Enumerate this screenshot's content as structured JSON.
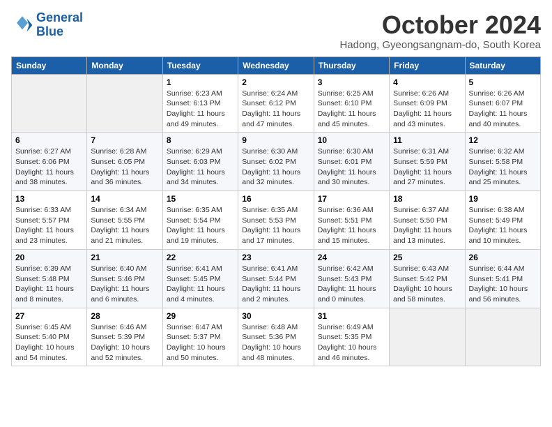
{
  "logo": {
    "line1": "General",
    "line2": "Blue"
  },
  "title": "October 2024",
  "subtitle": "Hadong, Gyeongsangnam-do, South Korea",
  "days_of_week": [
    "Sunday",
    "Monday",
    "Tuesday",
    "Wednesday",
    "Thursday",
    "Friday",
    "Saturday"
  ],
  "weeks": [
    [
      {
        "day": "",
        "content": ""
      },
      {
        "day": "",
        "content": ""
      },
      {
        "day": "1",
        "content": "Sunrise: 6:23 AM\nSunset: 6:13 PM\nDaylight: 11 hours and 49 minutes."
      },
      {
        "day": "2",
        "content": "Sunrise: 6:24 AM\nSunset: 6:12 PM\nDaylight: 11 hours and 47 minutes."
      },
      {
        "day": "3",
        "content": "Sunrise: 6:25 AM\nSunset: 6:10 PM\nDaylight: 11 hours and 45 minutes."
      },
      {
        "day": "4",
        "content": "Sunrise: 6:26 AM\nSunset: 6:09 PM\nDaylight: 11 hours and 43 minutes."
      },
      {
        "day": "5",
        "content": "Sunrise: 6:26 AM\nSunset: 6:07 PM\nDaylight: 11 hours and 40 minutes."
      }
    ],
    [
      {
        "day": "6",
        "content": "Sunrise: 6:27 AM\nSunset: 6:06 PM\nDaylight: 11 hours and 38 minutes."
      },
      {
        "day": "7",
        "content": "Sunrise: 6:28 AM\nSunset: 6:05 PM\nDaylight: 11 hours and 36 minutes."
      },
      {
        "day": "8",
        "content": "Sunrise: 6:29 AM\nSunset: 6:03 PM\nDaylight: 11 hours and 34 minutes."
      },
      {
        "day": "9",
        "content": "Sunrise: 6:30 AM\nSunset: 6:02 PM\nDaylight: 11 hours and 32 minutes."
      },
      {
        "day": "10",
        "content": "Sunrise: 6:30 AM\nSunset: 6:01 PM\nDaylight: 11 hours and 30 minutes."
      },
      {
        "day": "11",
        "content": "Sunrise: 6:31 AM\nSunset: 5:59 PM\nDaylight: 11 hours and 27 minutes."
      },
      {
        "day": "12",
        "content": "Sunrise: 6:32 AM\nSunset: 5:58 PM\nDaylight: 11 hours and 25 minutes."
      }
    ],
    [
      {
        "day": "13",
        "content": "Sunrise: 6:33 AM\nSunset: 5:57 PM\nDaylight: 11 hours and 23 minutes."
      },
      {
        "day": "14",
        "content": "Sunrise: 6:34 AM\nSunset: 5:55 PM\nDaylight: 11 hours and 21 minutes."
      },
      {
        "day": "15",
        "content": "Sunrise: 6:35 AM\nSunset: 5:54 PM\nDaylight: 11 hours and 19 minutes."
      },
      {
        "day": "16",
        "content": "Sunrise: 6:35 AM\nSunset: 5:53 PM\nDaylight: 11 hours and 17 minutes."
      },
      {
        "day": "17",
        "content": "Sunrise: 6:36 AM\nSunset: 5:51 PM\nDaylight: 11 hours and 15 minutes."
      },
      {
        "day": "18",
        "content": "Sunrise: 6:37 AM\nSunset: 5:50 PM\nDaylight: 11 hours and 13 minutes."
      },
      {
        "day": "19",
        "content": "Sunrise: 6:38 AM\nSunset: 5:49 PM\nDaylight: 11 hours and 10 minutes."
      }
    ],
    [
      {
        "day": "20",
        "content": "Sunrise: 6:39 AM\nSunset: 5:48 PM\nDaylight: 11 hours and 8 minutes."
      },
      {
        "day": "21",
        "content": "Sunrise: 6:40 AM\nSunset: 5:46 PM\nDaylight: 11 hours and 6 minutes."
      },
      {
        "day": "22",
        "content": "Sunrise: 6:41 AM\nSunset: 5:45 PM\nDaylight: 11 hours and 4 minutes."
      },
      {
        "day": "23",
        "content": "Sunrise: 6:41 AM\nSunset: 5:44 PM\nDaylight: 11 hours and 2 minutes."
      },
      {
        "day": "24",
        "content": "Sunrise: 6:42 AM\nSunset: 5:43 PM\nDaylight: 11 hours and 0 minutes."
      },
      {
        "day": "25",
        "content": "Sunrise: 6:43 AM\nSunset: 5:42 PM\nDaylight: 10 hours and 58 minutes."
      },
      {
        "day": "26",
        "content": "Sunrise: 6:44 AM\nSunset: 5:41 PM\nDaylight: 10 hours and 56 minutes."
      }
    ],
    [
      {
        "day": "27",
        "content": "Sunrise: 6:45 AM\nSunset: 5:40 PM\nDaylight: 10 hours and 54 minutes."
      },
      {
        "day": "28",
        "content": "Sunrise: 6:46 AM\nSunset: 5:39 PM\nDaylight: 10 hours and 52 minutes."
      },
      {
        "day": "29",
        "content": "Sunrise: 6:47 AM\nSunset: 5:37 PM\nDaylight: 10 hours and 50 minutes."
      },
      {
        "day": "30",
        "content": "Sunrise: 6:48 AM\nSunset: 5:36 PM\nDaylight: 10 hours and 48 minutes."
      },
      {
        "day": "31",
        "content": "Sunrise: 6:49 AM\nSunset: 5:35 PM\nDaylight: 10 hours and 46 minutes."
      },
      {
        "day": "",
        "content": ""
      },
      {
        "day": "",
        "content": ""
      }
    ]
  ]
}
